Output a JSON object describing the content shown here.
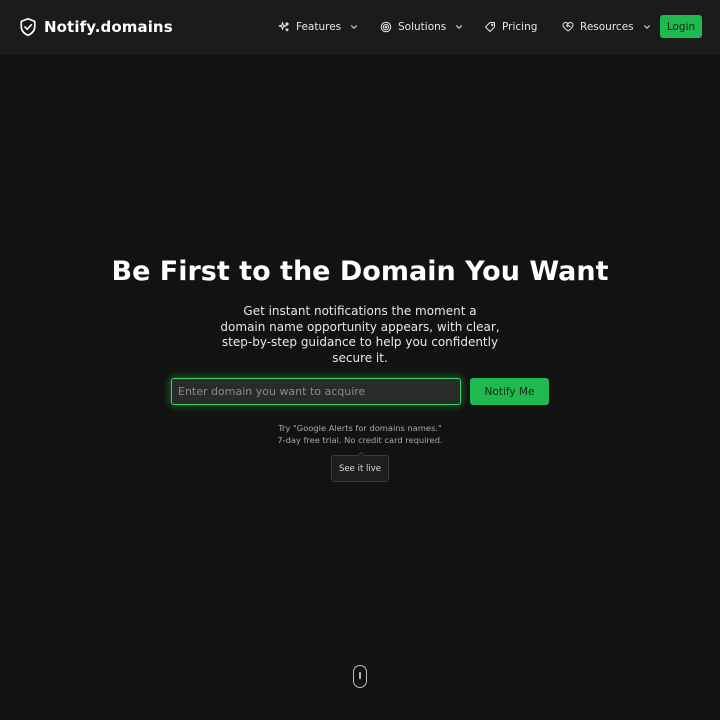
{
  "header": {
    "brand": {
      "name": "Notify.domains",
      "icon": "shield-check-icon"
    },
    "nav": [
      {
        "label": "Features",
        "icon": "sparkles-icon",
        "has_dropdown": true
      },
      {
        "label": "Solutions",
        "icon": "target-icon",
        "has_dropdown": true
      },
      {
        "label": "Pricing",
        "icon": "tag-icon",
        "has_dropdown": false
      },
      {
        "label": "Resources",
        "icon": "heart-handshake-icon",
        "has_dropdown": true
      }
    ],
    "login_label": "Login"
  },
  "hero": {
    "title": "Be First to the Domain You Want",
    "subtitle": "Get instant notifications the moment a domain name opportunity appears, with clear, step-by-step guidance to help you confidently secure it.",
    "input_placeholder": "Enter domain you want to acquire",
    "input_value": "",
    "notify_label": "Notify Me",
    "note_line1": "Try \"Google Alerts for domains names.\"",
    "note_line2": "7-day free trial. No credit card required.",
    "live_label": "See it live"
  },
  "scroll_indicator": {
    "icon": "mouse-scroll-icon"
  },
  "colors": {
    "background": "#121212",
    "header_bg": "#1b1b1b",
    "accent": "#20b94f",
    "input_glow": "#3fd46a"
  }
}
